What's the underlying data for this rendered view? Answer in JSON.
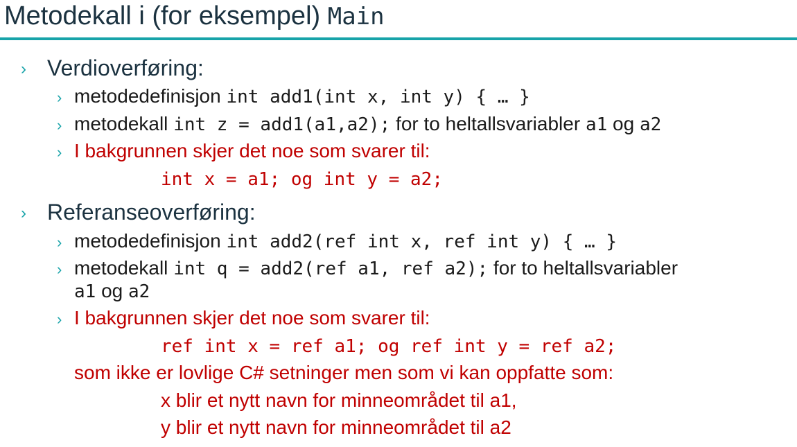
{
  "title": {
    "text": "Metodekall i (for eksempel) ",
    "code": "Main"
  },
  "sections": [
    {
      "bullet": "›",
      "heading": "Verdioverføring:",
      "items": [
        {
          "bullet": "›",
          "lead": "metodedefinisjon ",
          "code": "int add1(int x, int y) { … }"
        },
        {
          "bullet": "›",
          "lead": "metodekall ",
          "code": "int z = add1(a1,a2);",
          "tail1": " for to heltallsvariabler ",
          "code2": "a1",
          "tail2": " og ",
          "code3": "a2"
        },
        {
          "bullet": "›",
          "text": "I bakgrunnen skjer det noe som svarer til:",
          "code_line": "int x = a1; og int y = a2;"
        }
      ]
    },
    {
      "bullet": "›",
      "heading": "Referanseoverføring:",
      "items": [
        {
          "bullet": "›",
          "lead": "metodedefinisjon ",
          "code": "int add2(ref int x, ref int y) { … }"
        },
        {
          "bullet": "›",
          "lead": "metodekall ",
          "code": "int q = add2(ref a1, ref a2);",
          "tail1": " for to heltallsvariabler",
          "code2": "a1",
          "tail2": " og ",
          "code3": "a2"
        },
        {
          "bullet": "›",
          "text": "I bakgrunnen skjer det noe som svarer til:",
          "code_line": "ref int x = ref a1; og ref int y = ref a2;",
          "note": "som ikke er lovlige C# setninger men som vi kan oppfatte som:",
          "explain1": "x blir et nytt navn for minneområdet til a1,",
          "explain2": "y blir et nytt navn for minneområdet til a2"
        }
      ]
    }
  ],
  "colors": {
    "accent": "#17a3a9",
    "heading": "#1b3240",
    "red": "#c00000"
  }
}
